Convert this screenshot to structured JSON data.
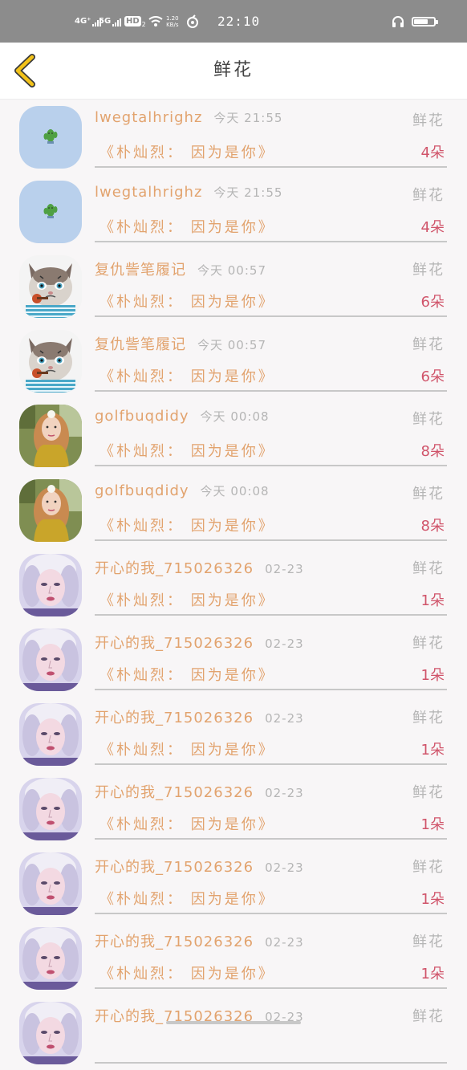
{
  "status_bar": {
    "net_1": "4G⁺",
    "net_2": "5G",
    "hd": "HD",
    "hd_sub": "2",
    "speed_value": "1.20",
    "speed_unit": "KB/s",
    "time": "22:10",
    "battery_icon": "battery-icon"
  },
  "header": {
    "title": "鲜花",
    "back_icon": "chevron-left-icon"
  },
  "gifts": [
    {
      "name": "lwegtalhrighz",
      "time": "今天 21:55",
      "type": "鲜花",
      "message": "《朴灿烈： 因为是你》",
      "count": "4朵",
      "avatar": "cactus"
    },
    {
      "name": "lwegtalhrighz",
      "time": "今天 21:55",
      "type": "鲜花",
      "message": "《朴灿烈： 因为是你》",
      "count": "4朵",
      "avatar": "cactus"
    },
    {
      "name": "复仇訾笔履记",
      "time": "今天 00:57",
      "type": "鲜花",
      "message": "《朴灿烈： 因为是你》",
      "count": "6朵",
      "avatar": "cat"
    },
    {
      "name": "复仇訾笔履记",
      "time": "今天 00:57",
      "type": "鲜花",
      "message": "《朴灿烈： 因为是你》",
      "count": "6朵",
      "avatar": "cat"
    },
    {
      "name": "golfbuqdidy",
      "time": "今天 00:08",
      "type": "鲜花",
      "message": "《朴灿烈： 因为是你》",
      "count": "8朵",
      "avatar": "girl"
    },
    {
      "name": "golfbuqdidy",
      "time": "今天 00:08",
      "type": "鲜花",
      "message": "《朴灿烈： 因为是你》",
      "count": "8朵",
      "avatar": "girl"
    },
    {
      "name": "开心的我_715026326",
      "time": "02-23",
      "type": "鲜花",
      "message": "《朴灿烈： 因为是你》",
      "count": "1朵",
      "avatar": "idol"
    },
    {
      "name": "开心的我_715026326",
      "time": "02-23",
      "type": "鲜花",
      "message": "《朴灿烈： 因为是你》",
      "count": "1朵",
      "avatar": "idol"
    },
    {
      "name": "开心的我_715026326",
      "time": "02-23",
      "type": "鲜花",
      "message": "《朴灿烈： 因为是你》",
      "count": "1朵",
      "avatar": "idol"
    },
    {
      "name": "开心的我_715026326",
      "time": "02-23",
      "type": "鲜花",
      "message": "《朴灿烈： 因为是你》",
      "count": "1朵",
      "avatar": "idol"
    },
    {
      "name": "开心的我_715026326",
      "time": "02-23",
      "type": "鲜花",
      "message": "《朴灿烈： 因为是你》",
      "count": "1朵",
      "avatar": "idol"
    },
    {
      "name": "开心的我_715026326",
      "time": "02-23",
      "type": "鲜花",
      "message": "《朴灿烈： 因为是你》",
      "count": "1朵",
      "avatar": "idol"
    },
    {
      "name": "开心的我_715026326",
      "time": "02-23",
      "type": "鲜花",
      "message": "",
      "count": "",
      "avatar": "idol"
    }
  ],
  "colors": {
    "name": "#e2a36e",
    "meta": "#b5b5b5",
    "count": "#d0546a",
    "back_icon": "#f2c21a"
  }
}
